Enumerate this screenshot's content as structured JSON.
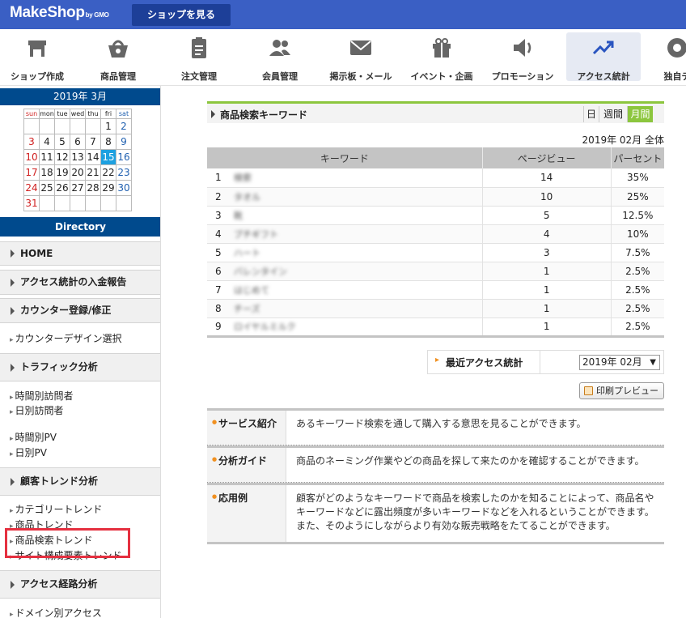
{
  "topbar": {
    "logo": "MakeShop",
    "logo_sub": "by GMO",
    "shop_button": "ショップを見る"
  },
  "nav": [
    {
      "label": "ショップ作成",
      "icon": "shop-icon"
    },
    {
      "label": "商品管理",
      "icon": "basket-icon"
    },
    {
      "label": "注文管理",
      "icon": "clipboard-icon"
    },
    {
      "label": "会員管理",
      "icon": "members-icon"
    },
    {
      "label": "掲示板・メール",
      "icon": "mail-icon"
    },
    {
      "label": "イベント・企画",
      "icon": "gift-icon"
    },
    {
      "label": "プロモーション",
      "icon": "speaker-icon"
    },
    {
      "label": "アクセス統計",
      "icon": "trend-icon"
    },
    {
      "label": "独自デ",
      "icon": "other-icon"
    }
  ],
  "calendar": {
    "title": "2019年 3月",
    "dow": [
      "sun",
      "mon",
      "tue",
      "wed",
      "thu",
      "fri",
      "sat"
    ],
    "weeks": [
      [
        "",
        "",
        "",
        "",
        "",
        "1",
        "2"
      ],
      [
        "3",
        "4",
        "5",
        "6",
        "7",
        "8",
        "9"
      ],
      [
        "10",
        "11",
        "12",
        "13",
        "14",
        "15",
        "16"
      ],
      [
        "17",
        "18",
        "19",
        "20",
        "21",
        "22",
        "23"
      ],
      [
        "24",
        "25",
        "26",
        "27",
        "28",
        "29",
        "30"
      ],
      [
        "31",
        "",
        "",
        "",
        "",
        "",
        ""
      ]
    ],
    "today": "15"
  },
  "sidebar": {
    "directory": "Directory",
    "home": "HOME",
    "sec_payment": "アクセス統計の入金報告",
    "sec_counter": "カウンター登録/修正",
    "counter_design": "カウンターデザイン選択",
    "sec_traffic": "トラフィック分析",
    "hourly_visitors": "時間別訪問者",
    "daily_visitors": "日別訪問者",
    "hourly_pv": "時間別PV",
    "daily_pv": "日別PV",
    "sec_customer_trend": "顧客トレンド分析",
    "category_trend": "カテゴリートレンド",
    "product_trend": "商品トレンド",
    "search_trend": "商品検索トレンド",
    "site_trend": "サイト構成要素トレンド",
    "sec_route": "アクセス経路分析",
    "domain_access": "ドメイン別アクセス"
  },
  "panel": {
    "title": "商品検索キーワード",
    "periods": [
      "日",
      "週間",
      "月間"
    ],
    "active_period": "月間",
    "date_label": "2019年 02月 全体"
  },
  "table": {
    "headers": [
      "キーワード",
      "ページビュー",
      "パーセント"
    ],
    "rows": [
      {
        "idx": "1",
        "keyword": "検索",
        "pv": "14",
        "pct": "35%"
      },
      {
        "idx": "2",
        "keyword": "タオル",
        "pv": "10",
        "pct": "25%"
      },
      {
        "idx": "3",
        "keyword": "靴",
        "pv": "5",
        "pct": "12.5%"
      },
      {
        "idx": "4",
        "keyword": "プチギフト",
        "pv": "4",
        "pct": "10%"
      },
      {
        "idx": "5",
        "keyword": "ハート",
        "pv": "3",
        "pct": "7.5%"
      },
      {
        "idx": "6",
        "keyword": "バレンタイン",
        "pv": "1",
        "pct": "2.5%"
      },
      {
        "idx": "7",
        "keyword": "はじめて",
        "pv": "1",
        "pct": "2.5%"
      },
      {
        "idx": "8",
        "keyword": "チーズ",
        "pv": "1",
        "pct": "2.5%"
      },
      {
        "idx": "9",
        "keyword": "ロイヤルミルク",
        "pv": "1",
        "pct": "2.5%"
      }
    ]
  },
  "recent": {
    "label": "最近アクセス統計",
    "selected_month": "2019年 02月"
  },
  "print_button": "印刷プレビュー",
  "info": [
    {
      "label": "サービス紹介",
      "text": "あるキーワード検索を通して購入する意思を見ることができます。"
    },
    {
      "label": "分析ガイド",
      "text": "商品のネーミング作業やどの商品を探して来たのかを確認することができます。"
    },
    {
      "label": "応用例",
      "text": "顧客がどのようなキーワードで商品を検索したのかを知ることによって、商品名やキーワードなどに露出頻度が多いキーワードなどを入れるということができます。また、そのようにしながらより有効な販売戦略をたてることができます。"
    }
  ]
}
